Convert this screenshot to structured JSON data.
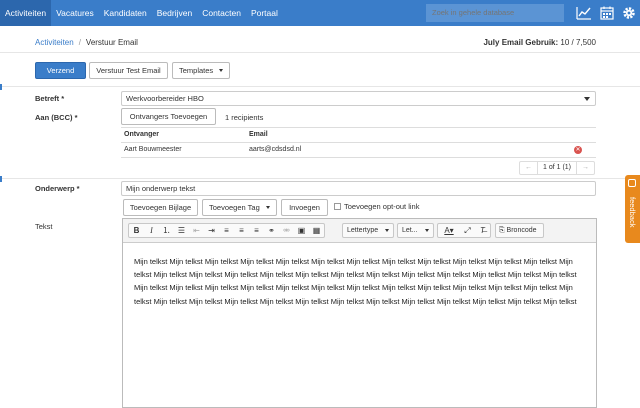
{
  "nav": {
    "items": [
      "Activiteiten",
      "Vacatures",
      "Kandidaten",
      "Bedrijven",
      "Contacten",
      "Portaal"
    ],
    "search_placeholder": "Zoek in gehele database"
  },
  "breadcrumb": {
    "parent": "Activiteiten",
    "separator": "/",
    "current": "Verstuur Email"
  },
  "usage": {
    "label": "July Email Gebruik:",
    "value": "10 / 7,500"
  },
  "actions": {
    "send": "Verzend",
    "test": "Verstuur Test Email",
    "templates": "Templates"
  },
  "form": {
    "subject_label": "Betreft *",
    "subject_value": "Werkvoorbereider HBO",
    "to_label": "Aan (BCC) *",
    "add_recipients": "Ontvangers Toevoegen",
    "recipients_count": "1 recipients",
    "table": {
      "headers": [
        "Ontvanger",
        "Email"
      ],
      "rows": [
        {
          "name": "Aart Bouwmeester",
          "email": "aarts@cdsdsd.nl"
        }
      ]
    },
    "pager": {
      "prev": "←",
      "page": "1 of 1 (1)",
      "next": "→"
    },
    "topic_label": "Onderwerp *",
    "topic_value": "Mijn onderwerp tekst",
    "add_attachment": "Toevoegen Bijlage",
    "add_tag": "Toevoegen Tag",
    "insert": "Invoegen",
    "optout": "Toevoegen opt-out link",
    "text_label": "Tekst"
  },
  "editor": {
    "font_dropdown": "Lettertype",
    "size_dropdown": "Let...",
    "source": "Broncode",
    "body": "Mijn telkst Mijn telkst Mijn telkst Mijn telkst Mijn telkst Mijn telkst Mijn telkst Mijn telkst Mijn telkst Mijn telkst Mijn telkst Mijn telkst Mijn telkst Mijn telkst Mijn telkst Mijn telkst Mijn telkst Mijn telkst Mijn telkst Mijn telkst Mijn telkst Mijn telkst Mijn telkst Mijn telkst Mijn telkst Mijn telkst Mijn telkst Mijn telkst Mijn telkst Mijn telkst Mijn telkst Mijn telkst Mijn telkst Mijn telkst Mijn telkst Mijn telkst Mijn telkst Mijn telkst Mijn telkst Mijn telkst Mijn telkst Mijn telkst Mijn telkst Mijn telkst Mijn telkst Mijn telkst Mijn telkst Mijn telkst Mijn telkst Mijn telkst"
  },
  "feedback": "feedback",
  "colors": {
    "nav": "#3a7dc9",
    "feedback": "#e8891d",
    "primary": "#3a7dc9"
  }
}
